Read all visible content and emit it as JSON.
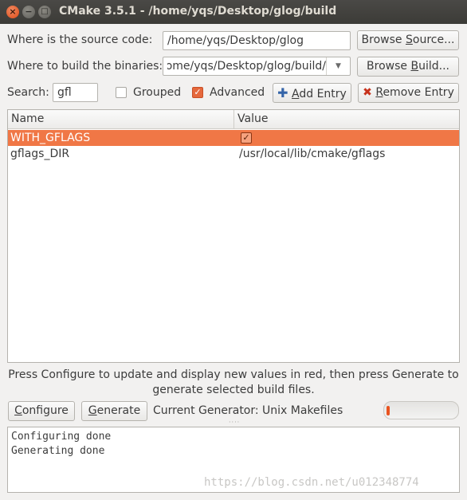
{
  "window": {
    "title": "CMake 3.5.1 - /home/yqs/Desktop/glog/build",
    "close_glyph": "×",
    "min_glyph": "−",
    "max_glyph": "□"
  },
  "source": {
    "label_pre": "Where is the source code:",
    "value": "/home/yqs/Desktop/glog",
    "browse_pre": "Browse ",
    "browse_key": "S",
    "browse_post": "ource..."
  },
  "build": {
    "label": "Where to build the binaries:",
    "value": "/home/yqs/Desktop/glog/build",
    "browse_pre": "Browse ",
    "browse_key": "B",
    "browse_post": "uild..."
  },
  "filter": {
    "search_label": "Search:",
    "search_value": "gfl",
    "grouped_label": "Grouped",
    "grouped_checked": false,
    "advanced_label": "Advanced",
    "advanced_checked": true,
    "add_entry_key": "A",
    "add_entry_post": "dd Entry",
    "remove_entry_key": "R",
    "remove_entry_post": "emove Entry"
  },
  "table": {
    "columns": [
      "Name",
      "Value"
    ],
    "rows": [
      {
        "name": "WITH_GFLAGS",
        "value": "",
        "checked": true,
        "selected": true
      },
      {
        "name": "gflags_DIR",
        "value": "/usr/local/lib/cmake/gflags",
        "selected": false
      }
    ]
  },
  "hint": {
    "line1": "Press Configure to update and display new values in red, then press Generate to",
    "line2": "generate selected build files."
  },
  "actions": {
    "configure_key": "C",
    "configure_post": "onfigure",
    "generate_key": "G",
    "generate_post": "enerate",
    "generator_text": "Current Generator: Unix Makefiles",
    "progress": 0.03
  },
  "output": {
    "lines": [
      "Configuring done",
      "Generating done"
    ]
  },
  "watermark": "https://blog.csdn.net/u012348774",
  "colors": {
    "accent": "#e95420",
    "selection": "#f07746"
  }
}
